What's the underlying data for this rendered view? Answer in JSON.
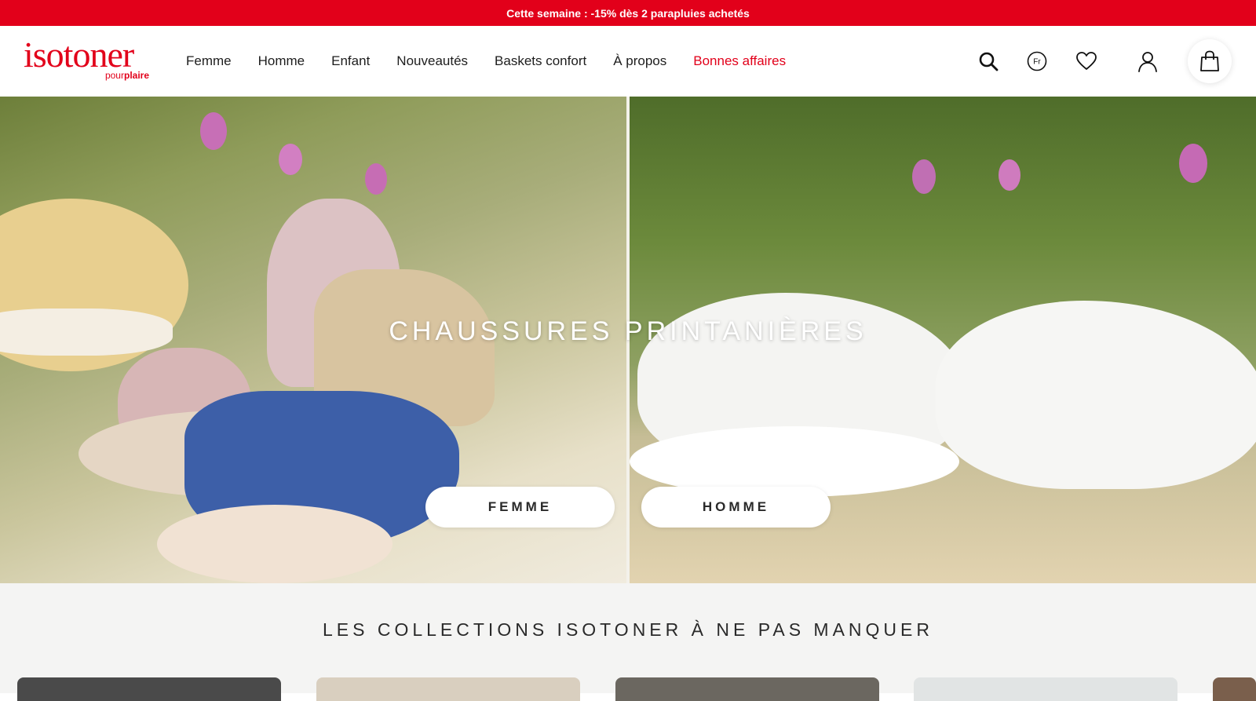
{
  "promo": {
    "text": "Cette semaine : -15% dès 2 parapluies achetés"
  },
  "logo": {
    "main": "isotoner",
    "sub_light": "pour",
    "sub_bold": "plaire"
  },
  "nav": {
    "items": [
      {
        "label": "Femme"
      },
      {
        "label": "Homme"
      },
      {
        "label": "Enfant"
      },
      {
        "label": "Nouveautés"
      },
      {
        "label": "Baskets confort"
      },
      {
        "label": "À propos"
      }
    ],
    "sale": {
      "label": "Bonnes affaires"
    }
  },
  "header_icons": {
    "search": "search-icon",
    "language": {
      "icon": "language-icon",
      "code": "Fr"
    },
    "wishlist": "heart-icon",
    "account": "user-icon",
    "cart": "shopping-bag-icon"
  },
  "hero": {
    "title": "CHAUSSURES PRINTANIÈRES",
    "left_button": "FEMME",
    "right_button": "HOMME"
  },
  "collections": {
    "title": "LES COLLECTIONS ISOTONER À NE PAS MANQUER"
  },
  "colors": {
    "brand_red": "#e2001a",
    "collections_bg": "#f4f4f3"
  }
}
